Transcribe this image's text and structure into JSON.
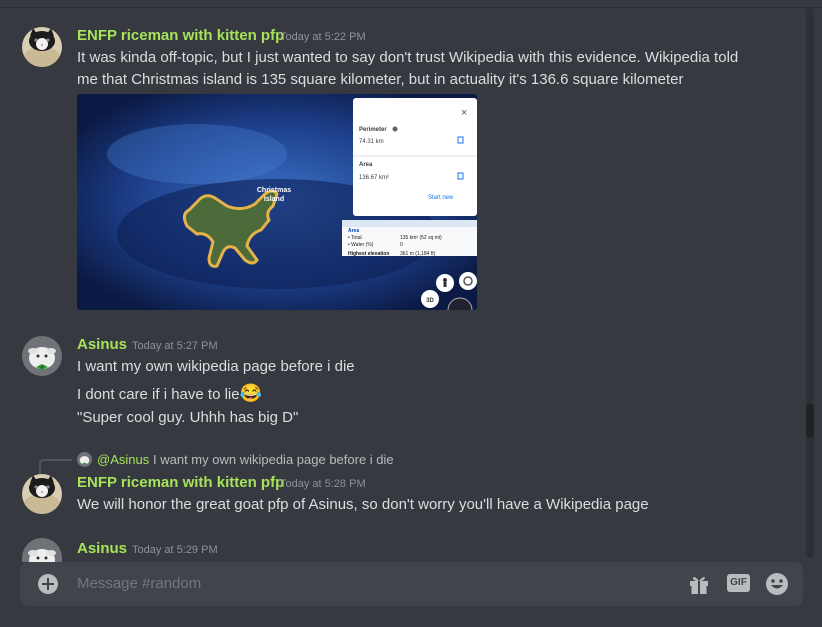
{
  "messages": [
    {
      "author": "ENFP riceman with kitten pfp",
      "timestamp": "Today at 5:22 PM",
      "lines": [
        "It was kinda off-topic, but I just wanted to say don't trust Wikipedia with this evidence. Wikipedia told",
        "me that Christmas island is 135 square kilometer, but in actuality it's 136.6 square kilometer"
      ],
      "attachment": {
        "island_label_1": "Christmas",
        "island_label_2": "Island",
        "measure_panel": {
          "perimeter_label": "Perimeter",
          "perimeter_value": "74.31 km",
          "area_label": "Area",
          "area_value": "136.67 km²",
          "start_new": "Start new",
          "close": "×"
        },
        "infobox": {
          "area_header": "Area",
          "total_label": "• Total",
          "total_value": "135 km² (52 sq mi)",
          "water_label": "• Water (%)",
          "water_value": "0",
          "elevation_label": "Highest elevation",
          "elevation_value": "361 m (1,184 ft)"
        },
        "btn_3d": "3D"
      }
    },
    {
      "author": "Asinus",
      "timestamp": "Today at 5:27 PM",
      "lines": [
        "I want my own wikipedia page before i die",
        "I dont care if i have to lie",
        "\"Super cool guy. Uhhh has big D\""
      ],
      "emoji": "😂"
    },
    {
      "reply_to_author": "@Asinus",
      "reply_text": "I want my own wikipedia page before i die",
      "author": "ENFP riceman with kitten pfp",
      "timestamp": "Today at 5:28 PM",
      "lines": [
        "We will honor the great goat pfp of Asinus, so don't worry you'll have a Wikipedia page"
      ]
    },
    {
      "author": "Asinus",
      "timestamp": "Today at 5:29 PM"
    }
  ],
  "composer": {
    "placeholder": "Message #random",
    "gif_label": "GIF"
  },
  "colors": {
    "background": "#36393f",
    "username": "#a6e35b",
    "text": "#dcddde",
    "timestamp": "#8e9297",
    "composer": "#40444b"
  },
  "icons": [
    "add-attachment-icon",
    "gift-icon",
    "gif-icon",
    "emoji-icon",
    "street-view-icon",
    "compass-icon",
    "copy-icon",
    "close-icon"
  ]
}
